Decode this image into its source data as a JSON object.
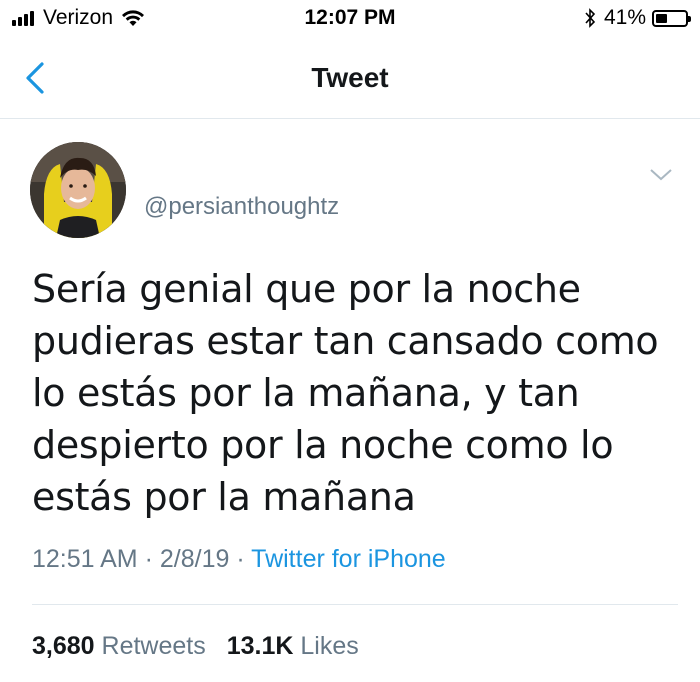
{
  "status_bar": {
    "carrier": "Verizon",
    "time": "12:07 PM",
    "battery_percent": "41%",
    "battery_level": 0.41
  },
  "nav": {
    "title": "Tweet",
    "back_icon": "chevron-left-icon"
  },
  "tweet": {
    "handle": "@persianthoughtz",
    "text_lines": [
      "Sería genial que por la noche",
      "pudieras estar tan cansado como",
      "lo estás por la mañana, y tan",
      "despierto por la noche como lo",
      "estás por la mañana"
    ],
    "time": "12:51 AM",
    "date": "2/8/19",
    "separator": "·",
    "source": "Twitter for iPhone",
    "retweets_count": "3,680",
    "retweets_label": "Retweets",
    "likes_count": "13.1K",
    "likes_label": "Likes"
  },
  "colors": {
    "accent": "#1b95e0",
    "secondary_text": "#657786",
    "divider": "#e1e8ed"
  }
}
